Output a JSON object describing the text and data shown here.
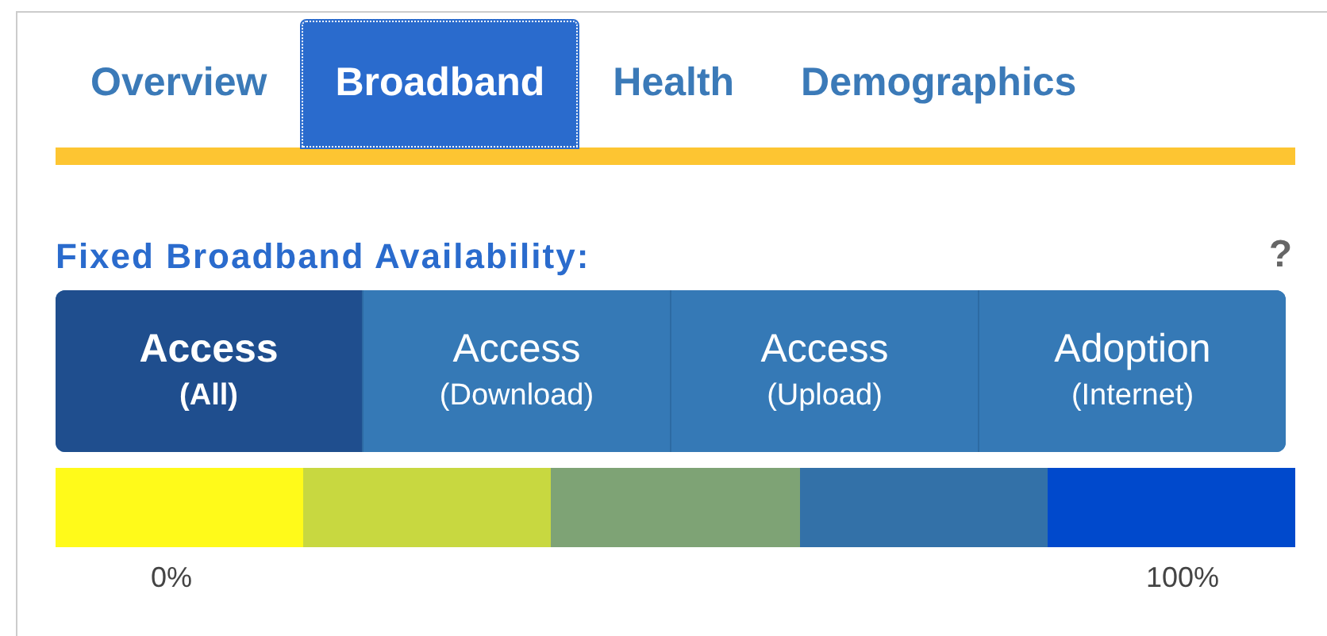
{
  "tabs": [
    {
      "label": "Overview",
      "selected": false
    },
    {
      "label": "Broadband",
      "selected": true
    },
    {
      "label": "Health",
      "selected": false
    },
    {
      "label": "Demographics",
      "selected": false
    }
  ],
  "section": {
    "title": "Fixed Broadband Availability:",
    "help": "?"
  },
  "toggles": [
    {
      "label": "Access",
      "sublabel": "(All)",
      "selected": true
    },
    {
      "label": "Access",
      "sublabel": "(Download)",
      "selected": false
    },
    {
      "label": "Access",
      "sublabel": "(Upload)",
      "selected": false
    },
    {
      "label": "Adoption",
      "sublabel": "(Internet)",
      "selected": false
    }
  ],
  "legend": {
    "swatches": [
      {
        "color": "#fffa1a"
      },
      {
        "color": "#c8d840"
      },
      {
        "color": "#7ea375"
      },
      {
        "color": "#3371a8"
      },
      {
        "color": "#0049cc"
      }
    ],
    "min_label": "0%",
    "max_label": "100%"
  }
}
